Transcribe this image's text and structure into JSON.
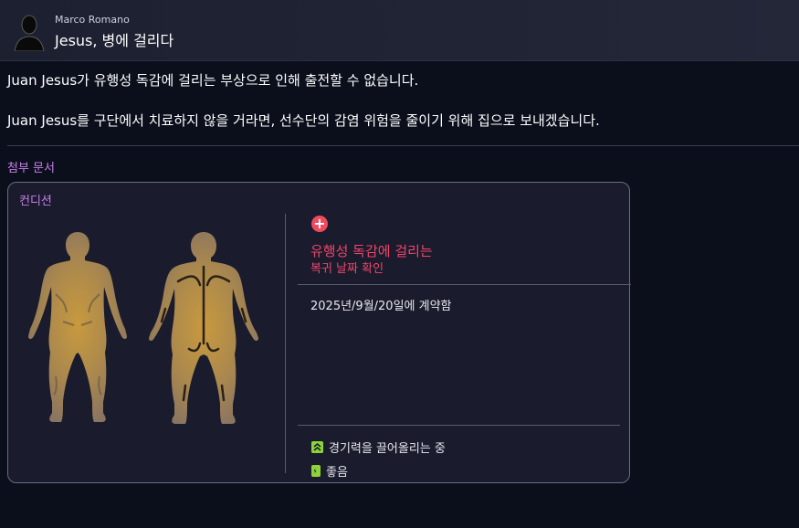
{
  "header": {
    "sender": "Marco Romano",
    "subject": "Jesus, 병에 걸리다"
  },
  "message": {
    "line1": "Juan Jesus가 유행성 독감에 걸리는 부상으로 인해 출전할 수 없습니다.",
    "line2": "Juan Jesus를 구단에서 치료하지 않을 거라면, 선수단의 감염 위험을 줄이기 위해 집으로 보내겠습니다."
  },
  "attachments": {
    "label": "첨부 문서"
  },
  "condition_card": {
    "title": "컨디션",
    "injury_name": "유행성 독감에 걸리는",
    "return_link": "복귀 날짜 확인",
    "contract_text": "2025년/9월/20일에 계약함",
    "status_items": [
      {
        "icon": "chevron-up-double-icon",
        "label": "경기력을 끌어올리는 중"
      },
      {
        "icon": "battery-charging-icon",
        "label": "좋음"
      }
    ],
    "colors": {
      "injury": "#f0456a",
      "accent": "#c77dea",
      "status_icon": "#8cd43a",
      "body": "#b08a4e"
    }
  }
}
